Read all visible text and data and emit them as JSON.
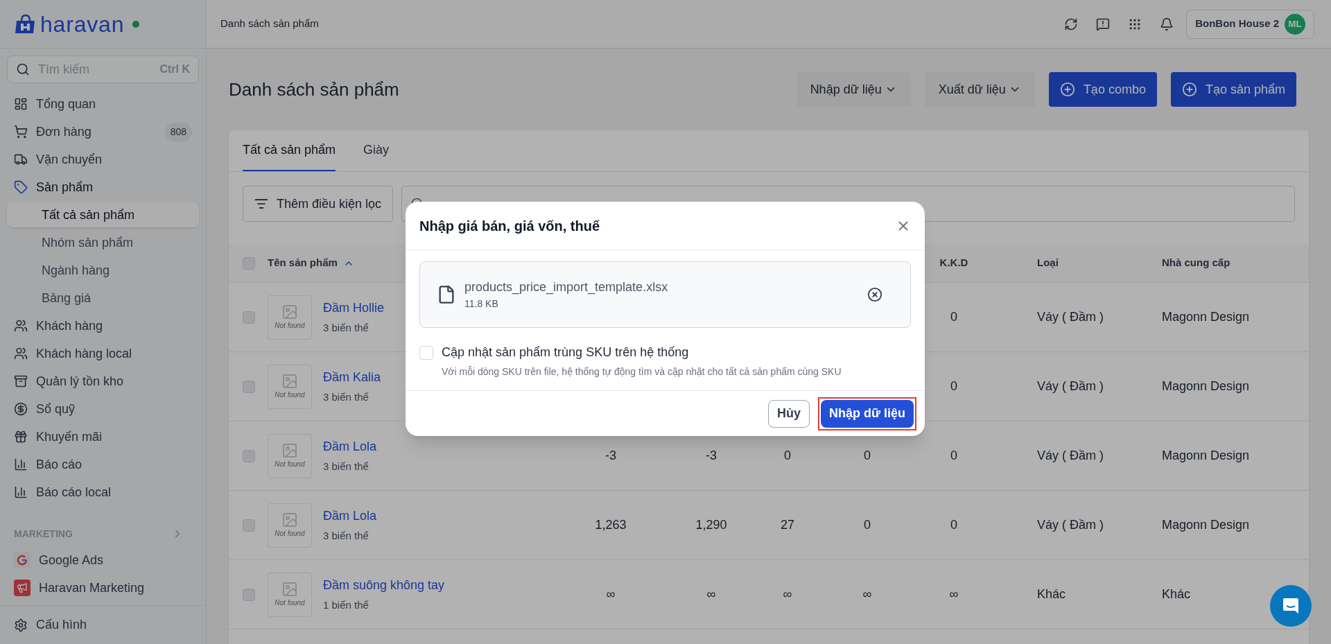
{
  "brand": {
    "name": "haravan",
    "online": true
  },
  "sidebar": {
    "search": {
      "placeholder": "Tìm kiếm",
      "shortcut": "Ctrl K"
    },
    "items": [
      {
        "label": "Tổng quan",
        "selected": false
      },
      {
        "label": "Đơn hàng",
        "badge": "808",
        "selected": false
      },
      {
        "label": "Vận chuyển",
        "selected": false
      },
      {
        "label": "Sản phẩm",
        "selected": true,
        "children": [
          {
            "label": "Tất cả sản phẩm",
            "selected": true
          },
          {
            "label": "Nhóm sản phẩm",
            "selected": false
          },
          {
            "label": "Ngành hàng",
            "selected": false
          },
          {
            "label": "Bảng giá",
            "selected": false
          }
        ]
      },
      {
        "label": "Khách hàng",
        "selected": false
      },
      {
        "label": "Khách hàng local",
        "selected": false
      },
      {
        "label": "Quản lý tồn kho",
        "selected": false
      },
      {
        "label": "Sổ quỹ",
        "selected": false
      },
      {
        "label": "Khuyến mãi",
        "selected": false
      },
      {
        "label": "Báo cáo",
        "selected": false
      },
      {
        "label": "Báo cáo local",
        "selected": false
      }
    ],
    "section_title": "MARKETING",
    "marketing_items": [
      {
        "label": "Google Ads"
      },
      {
        "label": "Haravan Marketing"
      }
    ],
    "footer_item": {
      "label": "Cấu hình"
    }
  },
  "topbar": {
    "breadcrumb": "Danh sách sản phẩm",
    "store": "BonBon House 2",
    "avatar": "ML"
  },
  "page": {
    "title": "Danh sách sản phẩm",
    "actions": [
      {
        "label": "Nhập dữ liệu",
        "kind": "dropdown"
      },
      {
        "label": "Xuất dữ liệu",
        "kind": "dropdown"
      },
      {
        "label": "Tạo combo",
        "kind": "primary"
      },
      {
        "label": "Tạo sản phẩm",
        "kind": "primary"
      }
    ]
  },
  "tabs": [
    {
      "label": "Tất cả sản phẩm",
      "selected": true
    },
    {
      "label": "Giày",
      "selected": false
    }
  ],
  "filter_button": "Thêm điều kiện lọc",
  "table": {
    "name_column": {
      "label": "Tên sản phẩm"
    },
    "columns": [
      "K.K.D",
      "Loại",
      "Nhà cung cấp"
    ],
    "header_checked": false,
    "rows": [
      {
        "name": "Đầm Hollie",
        "variants": "3 biến thể",
        "thumbnail_text": "Not found",
        "checked": false,
        "kkd": "0",
        "type": "Váy ( Đầm )",
        "vendor": "Magonn Design"
      },
      {
        "name": "Đầm Kalia",
        "variants": "3 biến thể",
        "thumbnail_text": "Not found",
        "checked": false,
        "kkd": "0",
        "type": "Váy ( Đầm )",
        "vendor": "Magonn Design"
      },
      {
        "name": "Đầm Lola",
        "variants": "3 biến thể",
        "thumbnail_text": "Not found",
        "checked": false,
        "values": [
          "-3",
          "-3",
          "0",
          "0"
        ],
        "kkd": "0",
        "type": "Váy ( Đầm )",
        "vendor": "Magonn Design"
      },
      {
        "name": "Đầm Lola",
        "variants": "3 biến thể",
        "thumbnail_text": "Not found",
        "checked": false,
        "values": [
          "1,263",
          "1,290",
          "27",
          "0"
        ],
        "kkd": "0",
        "type": "Váy ( Đầm )",
        "vendor": "Magonn Design"
      },
      {
        "name": "Đầm suông không tay",
        "variants": "1 biến thể",
        "thumbnail_text": "Not found",
        "checked": false,
        "values": [
          "∞",
          "∞",
          "∞",
          "∞"
        ],
        "kkd": "∞",
        "type": "Khác",
        "vendor": "Khác"
      }
    ]
  },
  "modal": {
    "title": "Nhập giá bán, giá vốn, thuế",
    "file": {
      "name": "products_price_import_template.xlsx",
      "size": "11.8 KB"
    },
    "option": {
      "label": "Cập nhật sản phẩm trùng SKU trên hệ thống",
      "hint": "Với mỗi dòng SKU trên file, hệ thống tự động tìm và cập nhật cho tất cả sản phẩm cùng SKU",
      "checked": false
    },
    "buttons": [
      {
        "label": "Hủy",
        "kind": "secondary",
        "highlighted": false
      },
      {
        "label": "Nhập dữ liệu",
        "kind": "primary",
        "highlighted": true
      }
    ]
  }
}
